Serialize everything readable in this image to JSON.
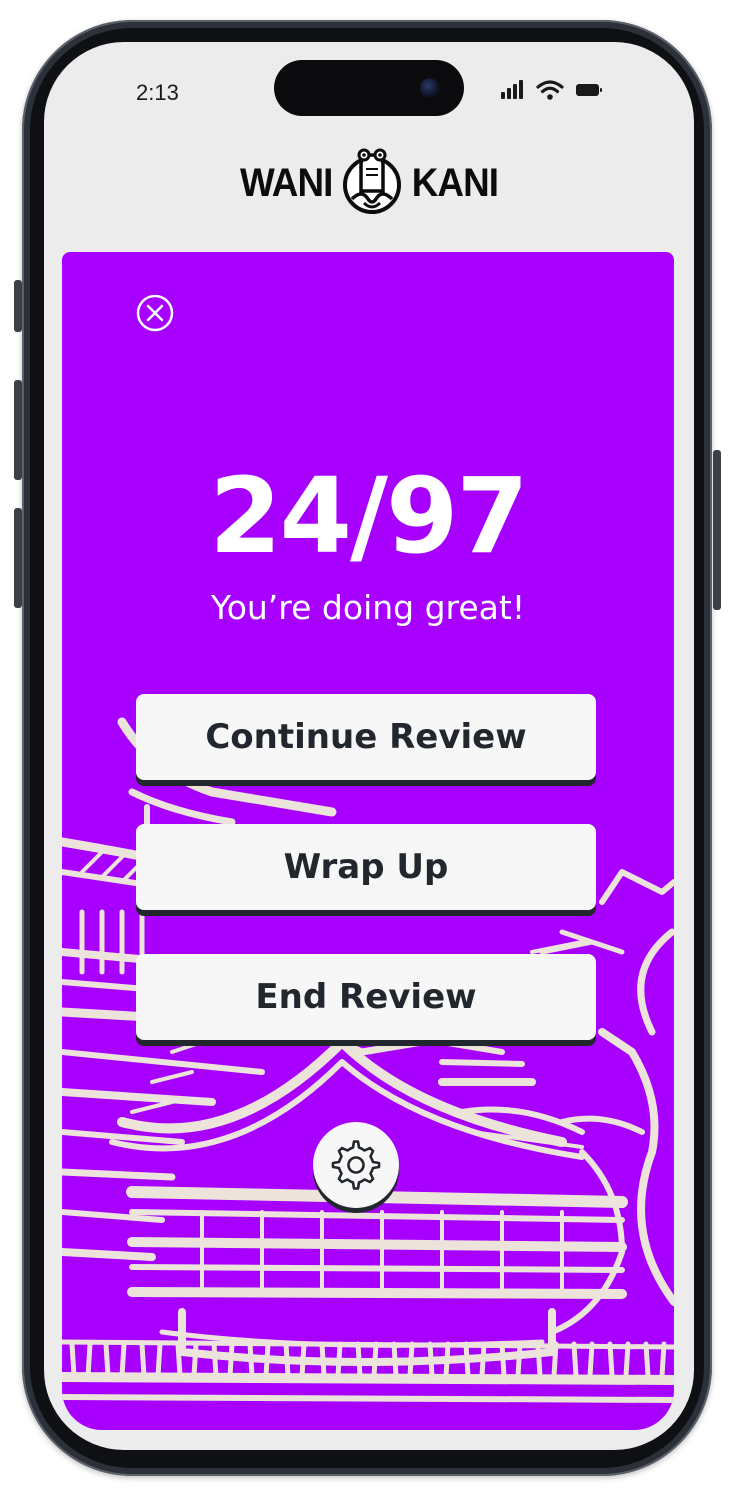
{
  "status_bar": {
    "time": "2:13",
    "icons": [
      "signal-icon",
      "wifi-icon",
      "battery-icon"
    ]
  },
  "logo": {
    "left_word": "WANI",
    "right_word": "KANI",
    "mascot_icon": "crocodile-mascot-icon"
  },
  "review": {
    "score": "24/97",
    "message": "You’re doing great!",
    "buttons": {
      "continue": "Continue Review",
      "wrap_up": "Wrap Up",
      "end": "End Review"
    },
    "close_icon": "close-icon",
    "settings_icon": "gear-icon"
  },
  "colors": {
    "accent_purple": "#a800ff",
    "button_bg": "#f7f7f7",
    "button_text": "#22262d",
    "illustration": "#ece4da"
  }
}
